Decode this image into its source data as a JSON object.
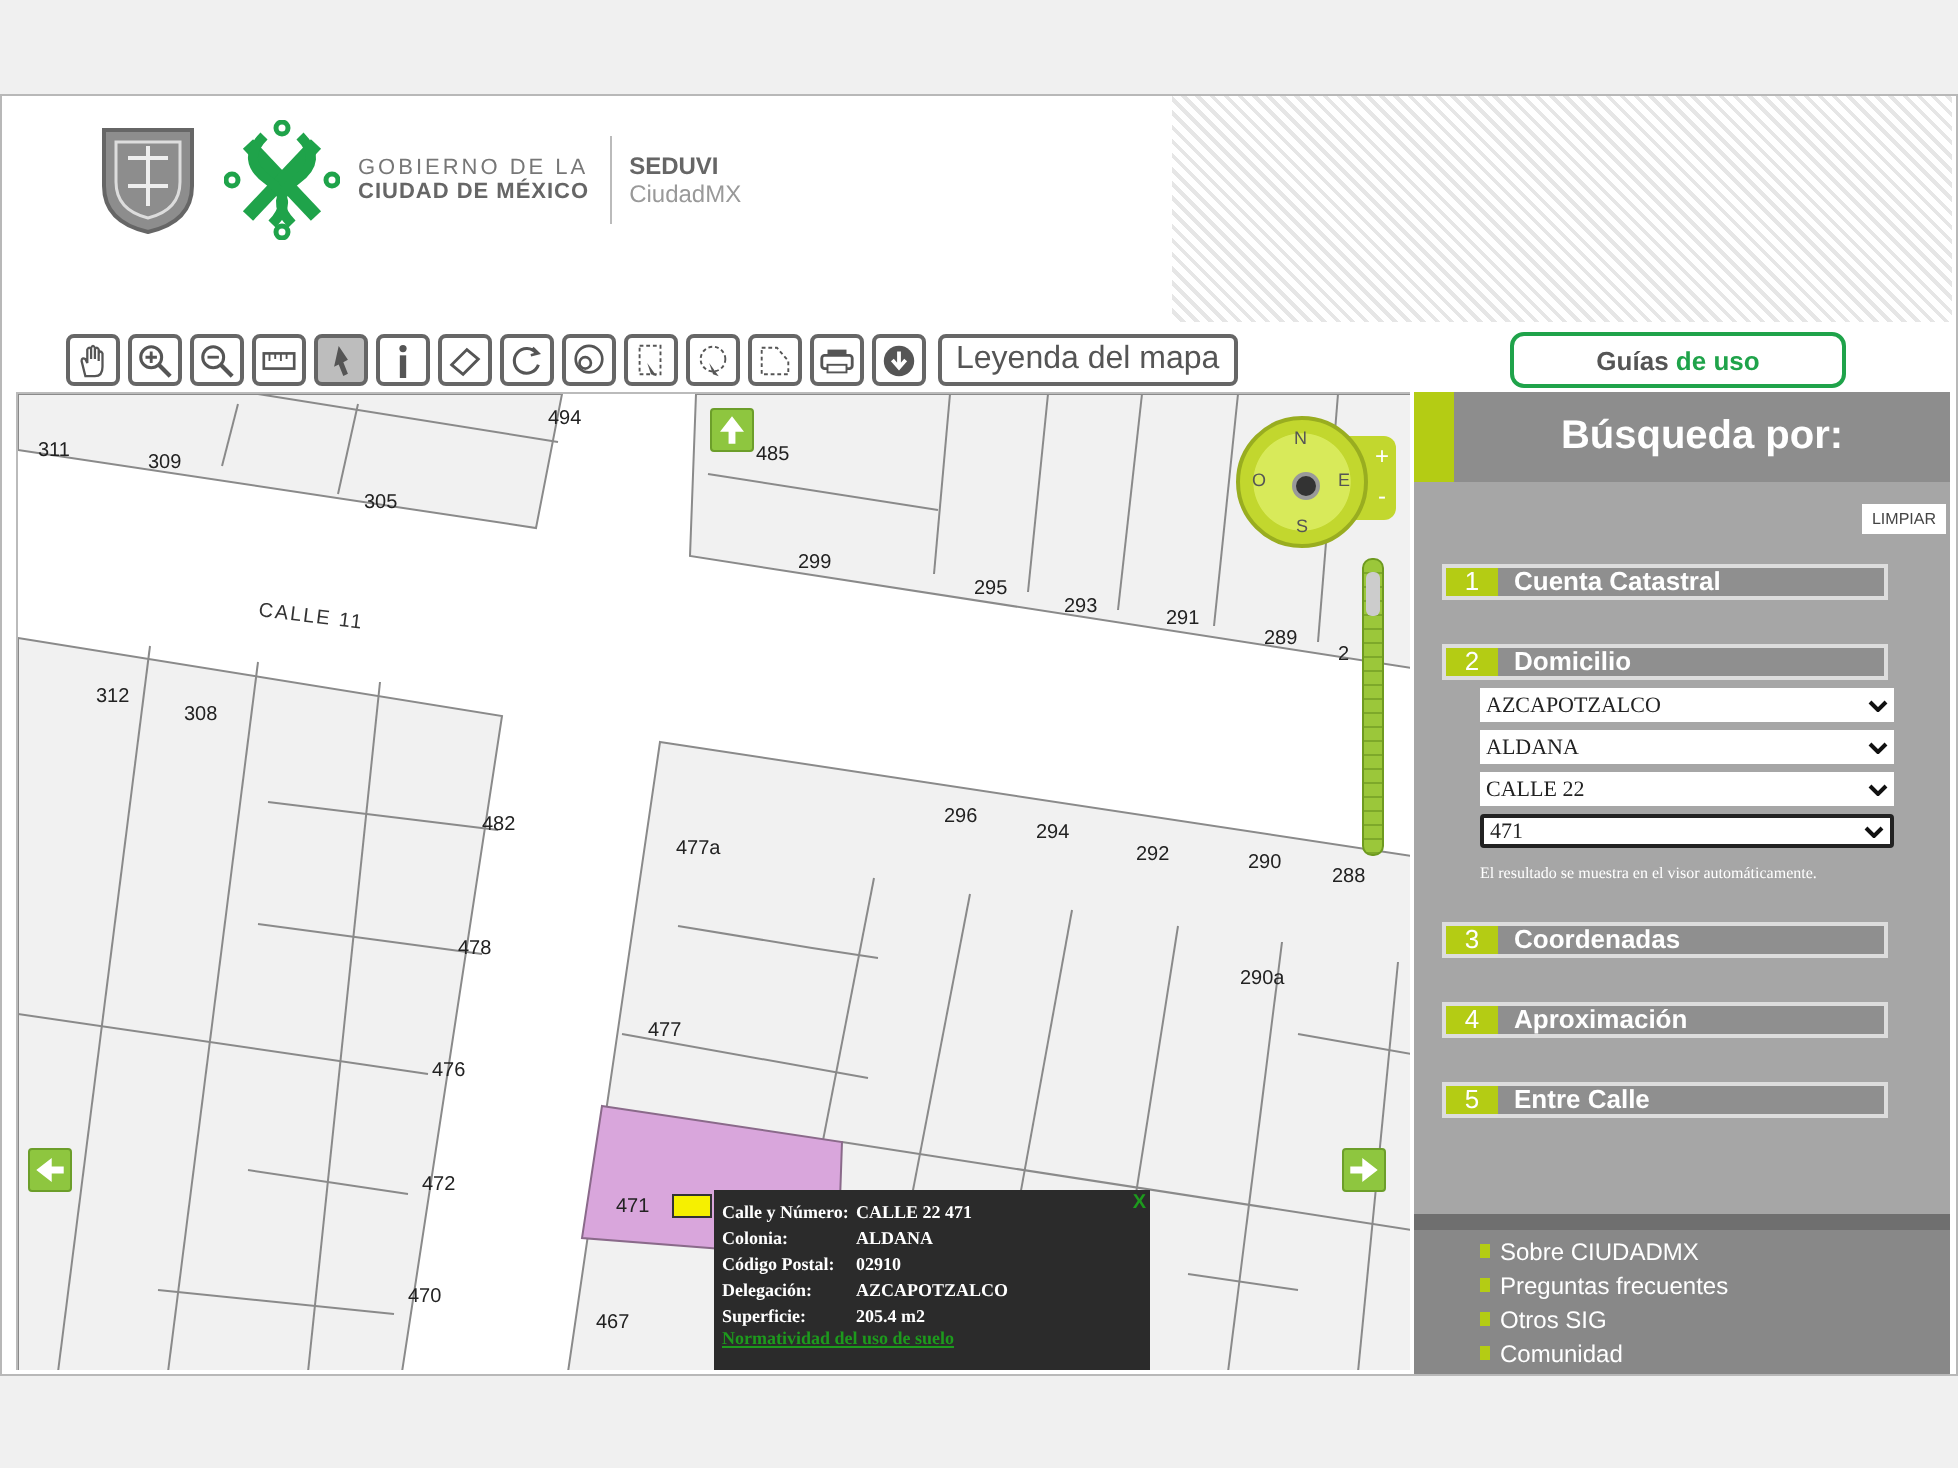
{
  "header": {
    "org_line1": "GOBIERNO DE LA",
    "org_line2": "CIUDAD DE MÉXICO",
    "agency": "SEDUVI",
    "agency_sub": "CiudadMX"
  },
  "toolbar": {
    "tools": [
      {
        "selected": false
      },
      {
        "selected": false
      },
      {
        "selected": false
      },
      {
        "selected": false
      },
      {
        "selected": true
      },
      {
        "selected": false
      },
      {
        "selected": false
      },
      {
        "selected": false
      },
      {
        "selected": false
      },
      {
        "selected": false
      },
      {
        "selected": false
      },
      {
        "selected": false
      },
      {
        "selected": false
      },
      {
        "selected": false
      }
    ],
    "legend_button": "Leyenda del mapa"
  },
  "guides_button": {
    "text": "Guías",
    "highlight": "de uso"
  },
  "map": {
    "street_label": "CALLE 11",
    "parcel_labels": [
      "494",
      "311",
      "309",
      "305",
      "485",
      "299",
      "295",
      "293",
      "291",
      "289",
      "2",
      "312",
      "308",
      "482",
      "477a",
      "296",
      "294",
      "292",
      "290",
      "288",
      "478",
      "290a",
      "477",
      "476",
      "472",
      "471",
      "470",
      "467"
    ],
    "compass": {
      "north": "N",
      "west": "O",
      "east": "E",
      "south": "S"
    },
    "zoom_buttons": [
      "+",
      "-"
    ],
    "zoom_slider": {
      "level": 0.95
    },
    "info_popup": {
      "close": "X",
      "rows": [
        {
          "label": "Calle y Número:",
          "value": "CALLE 22 471"
        },
        {
          "label": "Colonia:",
          "value": "ALDANA"
        },
        {
          "label": "Código Postal:",
          "value": "02910"
        },
        {
          "label": "Delegación:",
          "value": "AZCAPOTZALCO"
        },
        {
          "label": "Superficie:",
          "value": "205.4 m2"
        }
      ],
      "link": "Normatividad del uso de suelo"
    }
  },
  "search_panel": {
    "title": "Búsqueda por:",
    "clear_button": "LIMPIAR",
    "sections": [
      {
        "number": "1",
        "label": "Cuenta Catastral"
      },
      {
        "number": "2",
        "label": "Domicilio",
        "selects": [
          {
            "value": "AZCAPOTZALCO",
            "focused": false
          },
          {
            "value": "ALDANA",
            "focused": false
          },
          {
            "value": "CALLE 22",
            "focused": false
          },
          {
            "value": "471",
            "focused": true
          }
        ],
        "note": "El resultado se muestra en el visor automáticamente."
      },
      {
        "number": "3",
        "label": "Coordenadas"
      },
      {
        "number": "4",
        "label": "Aproximación"
      },
      {
        "number": "5",
        "label": "Entre Calle"
      }
    ],
    "links": [
      "Sobre CIUDADMX",
      "Preguntas frecuentes",
      "Otros SIG",
      "Comunidad"
    ]
  }
}
